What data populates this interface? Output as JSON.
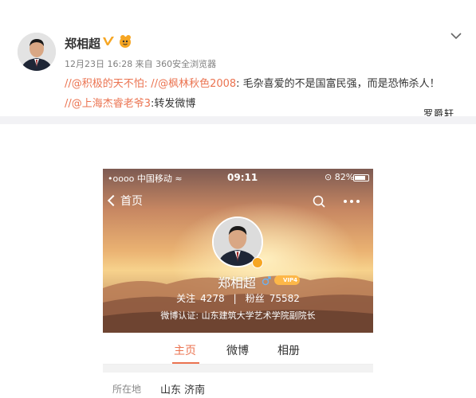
{
  "post": {
    "author": "郑相超",
    "meta": "12月23日 16:28 来自 360安全浏览器",
    "line1": {
      "slash1": "//",
      "mention1": "@积极的天不怕",
      "sep1": ": //",
      "mention2": "@枫林秋色2008",
      "text": ": 毛杂喜爱的不是国富民强，而是恐怖杀人！"
    },
    "line2": {
      "slash": "//",
      "mention": "@上海杰睿老爷3",
      "text": ":转发微博"
    },
    "watermark": "罗爵轩"
  },
  "phone": {
    "status": {
      "carrier": "•oooo 中国移动 ≈",
      "time": "09:11",
      "battery": "⊙ 82%",
      "battery_level": 0.82
    },
    "nav": {
      "back_label": "首页"
    },
    "profile": {
      "name": "郑相超",
      "vip_label": "VIP4",
      "stats": {
        "following_label": "关注",
        "following": "4278",
        "separator": "|",
        "followers_label": "粉丝",
        "followers": "75582"
      },
      "certification": "微博认证: 山东建筑大学艺术学院副院长"
    },
    "tabs": [
      "主页",
      "微博",
      "相册"
    ],
    "location": {
      "label": "所在地",
      "value": "山东 济南"
    }
  },
  "colors": {
    "accent": "#eb7350",
    "vip_gold": "#f6a623",
    "band": "#f2f2f5"
  },
  "icons": [
    "person-avatar-icon",
    "verified-v-icon",
    "vip-badge-icon",
    "chevron-down-icon",
    "back-chevron-icon",
    "search-icon",
    "more-icon",
    "male-gender-icon"
  ]
}
